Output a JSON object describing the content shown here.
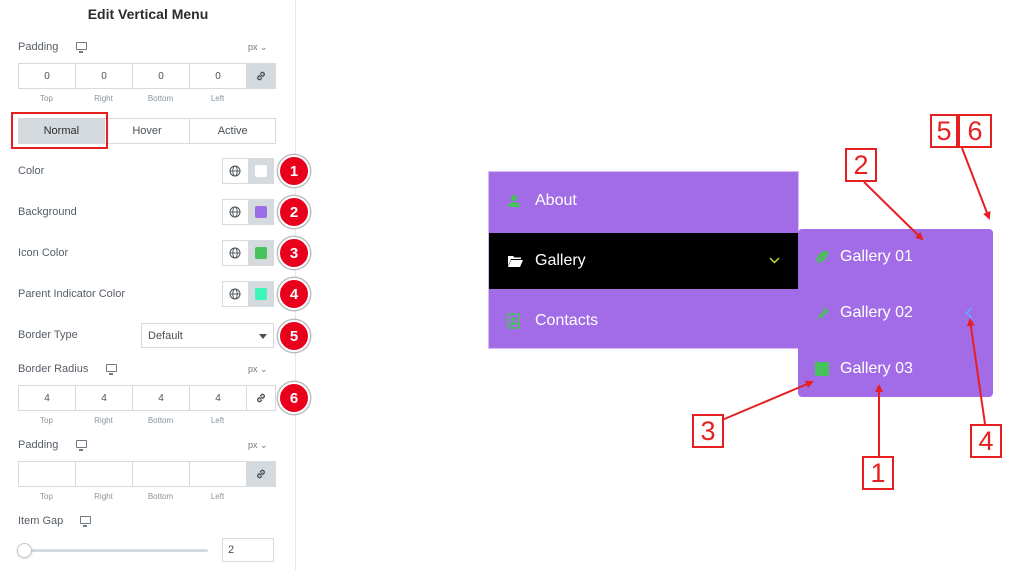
{
  "panel": {
    "title": "Edit Vertical Menu",
    "padding_top": {
      "label": "Padding",
      "unit": "px",
      "values": [
        "0",
        "0",
        "0",
        "0"
      ],
      "sides": [
        "Top",
        "Right",
        "Bottom",
        "Left"
      ]
    },
    "tabs": [
      "Normal",
      "Hover",
      "Active"
    ],
    "active_tab": "Normal",
    "color": {
      "label": "Color",
      "swatch": "#ffffff",
      "badge": "1"
    },
    "background": {
      "label": "Background",
      "swatch": "#9b6ee8",
      "badge": "2"
    },
    "icon_color": {
      "label": "Icon Color",
      "swatch": "#47c15a",
      "badge": "3"
    },
    "parent_indicator": {
      "label": "Parent Indicator Color",
      "swatch": "#3ef5b8",
      "badge": "4"
    },
    "border_type": {
      "label": "Border Type",
      "value": "Default",
      "badge": "5"
    },
    "border_radius": {
      "label": "Border Radius",
      "unit": "px",
      "values": [
        "4",
        "4",
        "4",
        "4"
      ],
      "sides": [
        "Top",
        "Right",
        "Bottom",
        "Left"
      ],
      "badge": "6"
    },
    "padding_bottom": {
      "label": "Padding",
      "unit": "px",
      "values": [
        "",
        "",
        "",
        ""
      ],
      "sides": [
        "Top",
        "Right",
        "Bottom",
        "Left"
      ]
    },
    "item_gap": {
      "label": "Item Gap",
      "value": "2",
      "slider_fraction": 0.0
    }
  },
  "preview": {
    "menu_items": [
      {
        "label": "About",
        "icon": "user-icon"
      },
      {
        "label": "Gallery",
        "icon": "folder-open-icon",
        "active": true
      },
      {
        "label": "Contacts",
        "icon": "contact-book-icon"
      }
    ],
    "submenu_items": [
      {
        "label": "Gallery 01",
        "icon": "leaf-icon"
      },
      {
        "label": "Gallery 02",
        "icon": "pin-icon"
      },
      {
        "label": "Gallery 03",
        "icon": "square-icon"
      }
    ],
    "callouts": [
      "1",
      "2",
      "3",
      "4",
      "5",
      "6"
    ]
  },
  "colors": {
    "menu_bg": "#a26ce6",
    "active_bg": "#000000",
    "icon_green": "#47c15a",
    "indicator": "#3ef5b8",
    "callout_red": "#e62020"
  }
}
